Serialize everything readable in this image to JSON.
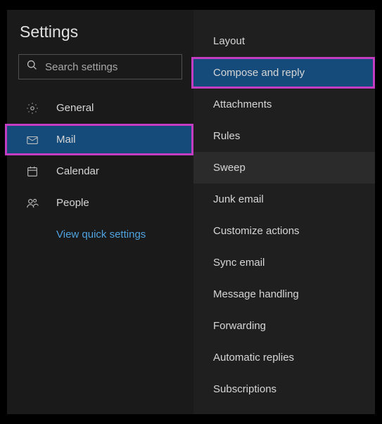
{
  "title": "Settings",
  "search": {
    "placeholder": "Search settings"
  },
  "nav": {
    "general": "General",
    "mail": "Mail",
    "calendar": "Calendar",
    "people": "People",
    "quick_settings": "View quick settings"
  },
  "subnav": {
    "layout": "Layout",
    "compose_reply": "Compose and reply",
    "attachments": "Attachments",
    "rules": "Rules",
    "sweep": "Sweep",
    "junk_email": "Junk email",
    "customize_actions": "Customize actions",
    "sync_email": "Sync email",
    "message_handling": "Message handling",
    "forwarding": "Forwarding",
    "automatic_replies": "Automatic replies",
    "subscriptions": "Subscriptions"
  }
}
